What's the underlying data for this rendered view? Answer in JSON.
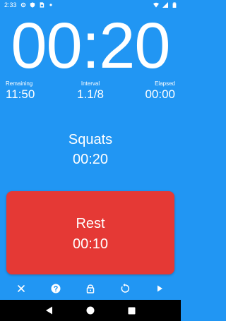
{
  "status_bar": {
    "time": "2:33",
    "left_icons": [
      "settings-icon",
      "shield-icon",
      "sim-card-icon",
      "notification-dot-icon"
    ],
    "right_icons": [
      "wifi-icon",
      "signal-icon",
      "battery-icon"
    ]
  },
  "timer": {
    "main_time": "00:20"
  },
  "stats": {
    "remaining": {
      "label": "Remaining",
      "value": "11:50"
    },
    "interval": {
      "label": "Interval",
      "value": "1.1/8"
    },
    "elapsed": {
      "label": "Elapsed",
      "value": "00:00"
    }
  },
  "current_exercise": {
    "name": "Squats",
    "time": "00:20"
  },
  "next_exercise": {
    "name": "Rest",
    "time": "00:10",
    "color": "#E53935"
  },
  "toolbar": {
    "icons": [
      "close-icon",
      "help-icon",
      "lock-icon",
      "restart-icon",
      "play-icon"
    ]
  },
  "nav_bar": {
    "icons": [
      "back-icon",
      "home-icon",
      "recents-icon"
    ]
  },
  "colors": {
    "background": "#2196F3",
    "text": "#FFFFFF",
    "nav_background": "#000000"
  }
}
